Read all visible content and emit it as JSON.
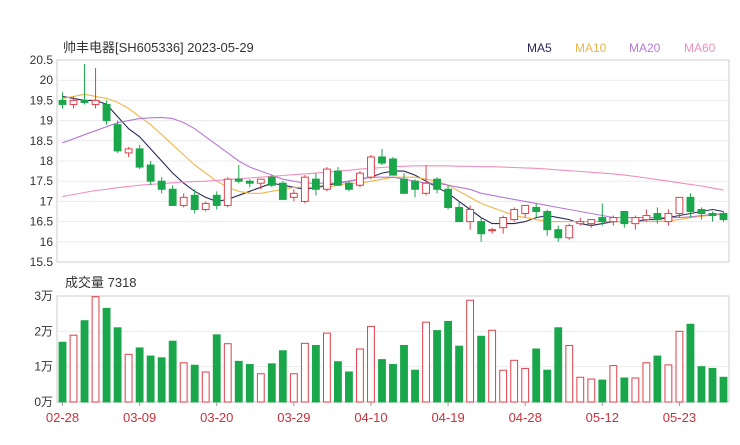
{
  "header": {
    "title": "帅丰电器[SH605336] 2023-05-29",
    "legend": [
      {
        "label": "MA5",
        "color": "#2a2a58"
      },
      {
        "label": "MA10",
        "color": "#f0b54a"
      },
      {
        "label": "MA20",
        "color": "#b57ad6"
      },
      {
        "label": "MA60",
        "color": "#ef8fbf"
      }
    ]
  },
  "volume_label": "成交量 7318",
  "chart_data": [
    {
      "type": "candlestick",
      "ylim": [
        15.5,
        20.5
      ],
      "y_ticks": [
        "20.5",
        "20",
        "19.5",
        "19",
        "18.5",
        "18",
        "17.5",
        "17",
        "16.5",
        "16",
        "15.5"
      ],
      "x_ticks": [
        "02-28",
        "03-09",
        "03-20",
        "03-29",
        "04-10",
        "04-19",
        "04-28",
        "05-12",
        "05-23"
      ],
      "x_tick_index": [
        0,
        7,
        14,
        21,
        28,
        35,
        42,
        49,
        56
      ],
      "ohlc": [
        [
          19.5,
          19.7,
          19.3,
          19.4
        ],
        [
          19.4,
          19.6,
          19.3,
          19.5
        ],
        [
          19.5,
          20.4,
          19.4,
          19.45
        ],
        [
          19.4,
          20.3,
          19.3,
          19.5
        ],
        [
          19.4,
          19.5,
          18.9,
          19.0
        ],
        [
          18.9,
          19.0,
          18.2,
          18.25
        ],
        [
          18.2,
          18.35,
          18.1,
          18.3
        ],
        [
          18.3,
          18.4,
          17.8,
          17.85
        ],
        [
          17.9,
          18.0,
          17.4,
          17.5
        ],
        [
          17.5,
          17.6,
          17.2,
          17.3
        ],
        [
          17.3,
          17.4,
          16.9,
          16.9
        ],
        [
          16.9,
          17.2,
          16.85,
          17.1
        ],
        [
          17.15,
          17.3,
          16.7,
          16.8
        ],
        [
          16.8,
          17.0,
          16.75,
          16.95
        ],
        [
          17.15,
          17.25,
          16.8,
          16.9
        ],
        [
          16.9,
          17.6,
          16.85,
          17.55
        ],
        [
          17.55,
          17.9,
          17.45,
          17.5
        ],
        [
          17.5,
          17.55,
          17.35,
          17.45
        ],
        [
          17.45,
          17.55,
          17.3,
          17.55
        ],
        [
          17.6,
          17.65,
          17.35,
          17.4
        ],
        [
          17.45,
          17.5,
          17.05,
          17.05
        ],
        [
          17.1,
          17.3,
          17.0,
          17.2
        ],
        [
          17.0,
          17.65,
          16.95,
          17.6
        ],
        [
          17.55,
          17.7,
          17.15,
          17.3
        ],
        [
          17.3,
          17.85,
          17.25,
          17.8
        ],
        [
          17.75,
          17.85,
          17.4,
          17.4
        ],
        [
          17.45,
          17.5,
          17.25,
          17.3
        ],
        [
          17.4,
          17.75,
          17.35,
          17.7
        ],
        [
          17.6,
          18.15,
          17.55,
          18.1
        ],
        [
          18.1,
          18.3,
          17.9,
          17.95
        ],
        [
          18.05,
          18.1,
          17.65,
          17.65
        ],
        [
          17.55,
          17.7,
          17.2,
          17.2
        ],
        [
          17.5,
          17.55,
          17.1,
          17.3
        ],
        [
          17.2,
          17.9,
          17.15,
          17.45
        ],
        [
          17.55,
          17.6,
          17.2,
          17.3
        ],
        [
          17.3,
          17.4,
          16.8,
          16.85
        ],
        [
          16.85,
          17.0,
          16.5,
          16.5
        ],
        [
          16.5,
          16.9,
          16.3,
          16.8
        ],
        [
          16.5,
          16.6,
          16.0,
          16.2
        ],
        [
          16.3,
          16.35,
          16.2,
          16.3
        ],
        [
          16.35,
          16.65,
          16.2,
          16.6
        ],
        [
          16.55,
          16.85,
          16.5,
          16.8
        ],
        [
          16.7,
          16.9,
          16.6,
          16.9
        ],
        [
          16.85,
          16.95,
          16.6,
          16.75
        ],
        [
          16.75,
          16.8,
          16.15,
          16.3
        ],
        [
          16.3,
          16.4,
          16.0,
          16.1
        ],
        [
          16.1,
          16.45,
          16.05,
          16.4
        ],
        [
          16.45,
          16.6,
          16.4,
          16.5
        ],
        [
          16.45,
          16.55,
          16.35,
          16.55
        ],
        [
          16.6,
          16.95,
          16.4,
          16.5
        ],
        [
          16.5,
          16.65,
          16.4,
          16.6
        ],
        [
          16.75,
          16.75,
          16.35,
          16.45
        ],
        [
          16.45,
          16.65,
          16.3,
          16.6
        ],
        [
          16.55,
          16.8,
          16.5,
          16.65
        ],
        [
          16.7,
          16.85,
          16.45,
          16.55
        ],
        [
          16.5,
          16.8,
          16.4,
          16.7
        ],
        [
          16.7,
          17.1,
          16.6,
          17.1
        ],
        [
          17.1,
          17.2,
          16.6,
          16.75
        ],
        [
          16.8,
          16.85,
          16.55,
          16.7
        ],
        [
          16.7,
          16.75,
          16.5,
          16.65
        ],
        [
          16.7,
          16.75,
          16.5,
          16.55
        ]
      ],
      "series": [
        {
          "name": "MA5",
          "color": "#2a2a58",
          "values": [
            19.6,
            19.55,
            19.5,
            19.5,
            19.4,
            19.1,
            18.8,
            18.6,
            18.3,
            18.0,
            17.7,
            17.45,
            17.25,
            17.1,
            17.0,
            17.05,
            17.15,
            17.25,
            17.35,
            17.45,
            17.4,
            17.35,
            17.3,
            17.35,
            17.4,
            17.45,
            17.5,
            17.55,
            17.6,
            17.7,
            17.75,
            17.75,
            17.65,
            17.5,
            17.35,
            17.2,
            17.0,
            16.8,
            16.6,
            16.45,
            16.45,
            16.45,
            16.5,
            16.6,
            16.65,
            16.6,
            16.55,
            16.45,
            16.4,
            16.45,
            16.5,
            16.5,
            16.5,
            16.55,
            16.55,
            16.6,
            16.65,
            16.7,
            16.75,
            16.8,
            16.75
          ]
        },
        {
          "name": "MA10",
          "color": "#f0b54a",
          "values": [
            19.55,
            19.6,
            19.65,
            19.6,
            19.55,
            19.45,
            19.3,
            19.1,
            18.9,
            18.65,
            18.4,
            18.15,
            17.9,
            17.7,
            17.5,
            17.35,
            17.25,
            17.2,
            17.2,
            17.25,
            17.3,
            17.35,
            17.35,
            17.35,
            17.35,
            17.4,
            17.45,
            17.45,
            17.5,
            17.55,
            17.6,
            17.6,
            17.6,
            17.55,
            17.5,
            17.4,
            17.25,
            17.1,
            16.95,
            16.85,
            16.75,
            16.65,
            16.6,
            16.55,
            16.5,
            16.5,
            16.5,
            16.5,
            16.5,
            16.5,
            16.5,
            16.5,
            16.5,
            16.5,
            16.5,
            16.52,
            16.55,
            16.6,
            16.63,
            16.66,
            16.68
          ]
        },
        {
          "name": "MA20",
          "color": "#b57ad6",
          "values": [
            18.45,
            18.55,
            18.65,
            18.75,
            18.85,
            18.95,
            19.0,
            19.05,
            19.07,
            19.08,
            19.05,
            18.95,
            18.8,
            18.6,
            18.4,
            18.2,
            18.0,
            17.85,
            17.75,
            17.65,
            17.55,
            17.5,
            17.45,
            17.45,
            17.45,
            17.45,
            17.5,
            17.55,
            17.6,
            17.6,
            17.6,
            17.55,
            17.5,
            17.45,
            17.45,
            17.4,
            17.35,
            17.3,
            17.2,
            17.15,
            17.1,
            17.05,
            17.0,
            16.95,
            16.9,
            16.85,
            16.8,
            16.75,
            16.7,
            16.65,
            16.6,
            16.6,
            16.6,
            16.6,
            16.6,
            16.6,
            16.6,
            16.62,
            16.65,
            16.67,
            16.7
          ]
        },
        {
          "name": "MA60",
          "color": "#ef8fbf",
          "values": [
            17.12,
            17.17,
            17.22,
            17.27,
            17.3,
            17.34,
            17.37,
            17.4,
            17.42,
            17.44,
            17.46,
            17.48,
            17.49,
            17.5,
            17.52,
            17.54,
            17.56,
            17.58,
            17.6,
            17.62,
            17.64,
            17.66,
            17.68,
            17.7,
            17.72,
            17.75,
            17.77,
            17.8,
            17.82,
            17.84,
            17.86,
            17.87,
            17.88,
            17.88,
            17.88,
            17.88,
            17.87,
            17.87,
            17.86,
            17.86,
            17.85,
            17.84,
            17.83,
            17.82,
            17.8,
            17.78,
            17.76,
            17.74,
            17.72,
            17.7,
            17.68,
            17.65,
            17.62,
            17.58,
            17.54,
            17.5,
            17.46,
            17.42,
            17.38,
            17.33,
            17.28
          ]
        }
      ]
    },
    {
      "type": "bar",
      "ylim": [
        0,
        30000
      ],
      "y_ticks": [
        "3万",
        "2万",
        "1万",
        "0万"
      ],
      "y_tick_values": [
        30000,
        20000,
        10000,
        0
      ],
      "values": [
        16900,
        18900,
        23000,
        29800,
        26500,
        21000,
        13500,
        15300,
        13000,
        12500,
        17200,
        11100,
        10400,
        8500,
        19000,
        16500,
        11500,
        10600,
        8000,
        10800,
        14500,
        8000,
        16600,
        16000,
        19500,
        11400,
        8500,
        15000,
        21400,
        12000,
        10600,
        16000,
        9000,
        22600,
        20200,
        22800,
        15800,
        28800,
        18600,
        20300,
        9000,
        11800,
        9500,
        15000,
        9000,
        21000,
        16000,
        7000,
        6500,
        6200,
        10300,
        6800,
        6800,
        11100,
        13000,
        10500,
        20000,
        22000,
        10000,
        9500,
        7000
      ]
    }
  ]
}
